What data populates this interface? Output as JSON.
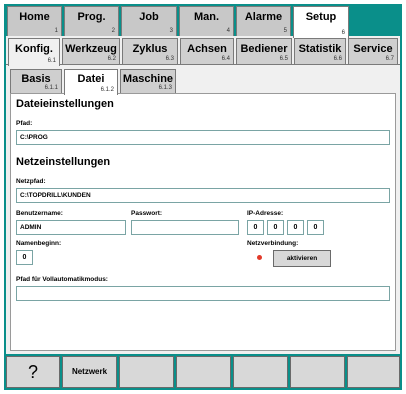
{
  "top_tabs": [
    {
      "label": "Home",
      "num": "1"
    },
    {
      "label": "Prog.",
      "num": "2"
    },
    {
      "label": "Job",
      "num": "3"
    },
    {
      "label": "Man.",
      "num": "4"
    },
    {
      "label": "Alarme",
      "num": "5"
    },
    {
      "label": "Setup",
      "num": "6"
    }
  ],
  "setup_tabs": [
    {
      "label": "Konfig.",
      "num": "6.1"
    },
    {
      "label": "Werkzeug",
      "num": "6.2"
    },
    {
      "label": "Zyklus",
      "num": "6.3"
    },
    {
      "label": "Achsen",
      "num": "6.4"
    },
    {
      "label": "Bediener",
      "num": "6.5"
    },
    {
      "label": "Statistik",
      "num": "6.6"
    },
    {
      "label": "Service",
      "num": "6.7"
    }
  ],
  "konfig_tabs": [
    {
      "label": "Basis",
      "num": "6.1.1"
    },
    {
      "label": "Datei",
      "num": "6.1.2"
    },
    {
      "label": "Maschine",
      "num": "6.1.3"
    }
  ],
  "datei": {
    "heading": "Dateieinstellungen",
    "pfad_label": "Pfad:",
    "pfad_value": "C:\\PROG"
  },
  "netz": {
    "heading": "Netzeinstellungen",
    "netzpfad_label": "Netzpfad:",
    "netzpfad_value": "C:\\TOPDRILL\\KUNDEN",
    "benutzer_label": "Benutzername:",
    "benutzer_value": "ADMIN",
    "passwort_label": "Passwort:",
    "passwort_value": "",
    "ip_label": "IP-Adresse:",
    "ip": [
      "0",
      "0",
      "0",
      "0"
    ],
    "namensbeginn_label": "Namenbeginn:",
    "namensbeginn_value": "0",
    "verbindung_label": "Netzverbindung:",
    "aktivieren_label": "aktivieren",
    "vollauto_label": "Pfad für Vollautomatikmodus:",
    "vollauto_value": ""
  },
  "softkeys": {
    "help": "?",
    "netzwerk": "Netzwerk"
  },
  "colors": {
    "frame": "#0a8f8a",
    "status_dot": "#e23a2a"
  }
}
